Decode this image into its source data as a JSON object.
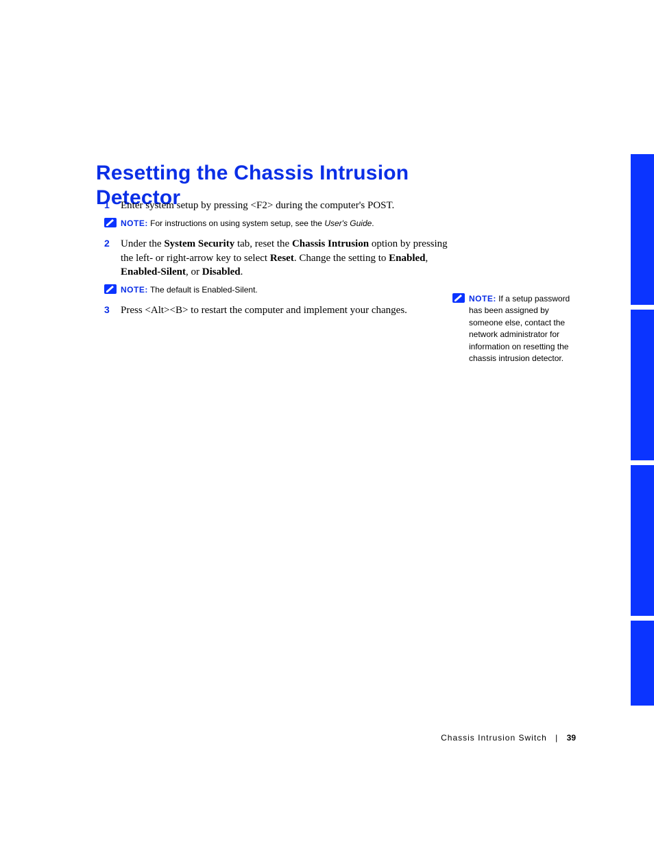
{
  "heading": "Resetting the Chassis Intrusion Detector",
  "steps": {
    "s1": {
      "num": "1",
      "text_before": "Enter system setup by pressing <F2> during the computer's POST."
    },
    "note1": {
      "label": "NOTE:",
      "text_before": " For instructions on using system setup, see the ",
      "italic": "User's Guide",
      "text_after": "."
    },
    "s2": {
      "num": "2",
      "a": "Under the ",
      "b1": "System Security",
      "c": " tab, reset the ",
      "b2": "Chassis Intrusion",
      "d": " option by pressing the left- or right-arrow key to select ",
      "b3": "Reset",
      "e": ". Change the setting to ",
      "b4": "Enabled",
      "f": ", ",
      "b5": "Enabled-Silent",
      "g": ", or ",
      "b6": "Disabled",
      "h": "."
    },
    "note2": {
      "label": "NOTE:",
      "text_before": " The default is ",
      "ref": "Enabled-Silent",
      "text_after": "."
    },
    "s3": {
      "num": "3",
      "text_before": "Press <Alt><B> to restart the computer and implement your changes."
    }
  },
  "side_note": {
    "label": "NOTE:",
    "text": " If a setup password has been assigned by someone else, contact the network administrator for information on resetting the chassis intrusion detector."
  },
  "footer": {
    "section": "Chassis Intrusion Switch",
    "page": "39"
  }
}
